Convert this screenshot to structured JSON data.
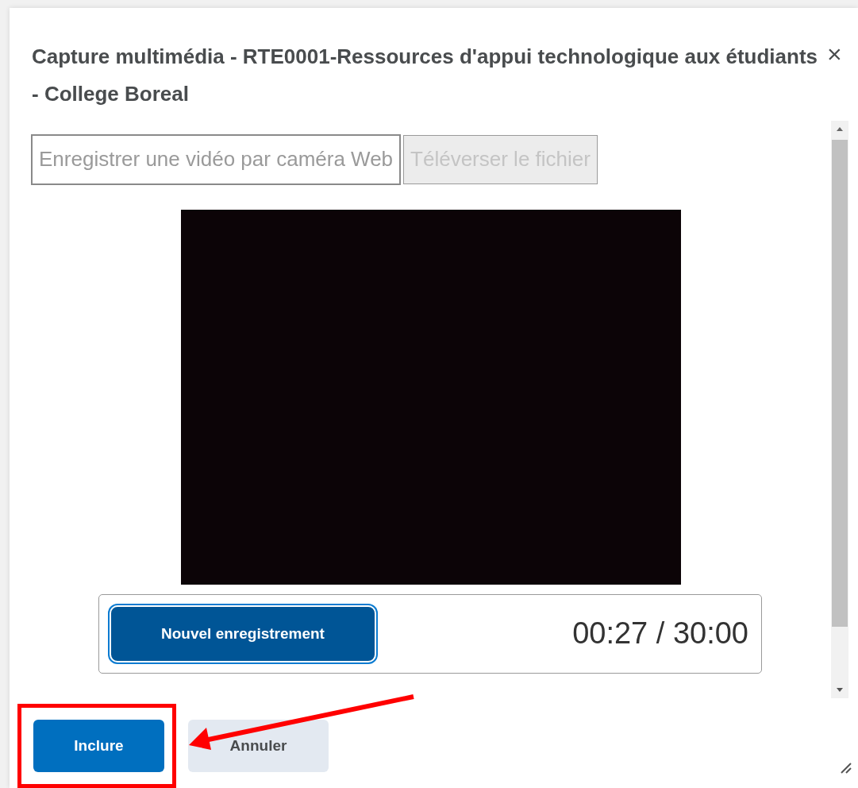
{
  "dialog": {
    "title": "Capture multimédia - RTE0001-Ressources d'appui technologique aux étudiants - College Boreal",
    "close": "×"
  },
  "tabs": [
    {
      "label": "Enregistrer une vidéo par caméra Web",
      "selected": true,
      "disabled": false
    },
    {
      "label": "Téléverser le fichier",
      "selected": false,
      "disabled": true
    }
  ],
  "recorder": {
    "button": "Nouvel enregistrement",
    "time": "00:27 / 30:00"
  },
  "footer": {
    "buttons": [
      {
        "label": "Inclure",
        "kind": "primary",
        "highlighted": true
      },
      {
        "label": "Annuler",
        "kind": "secondary",
        "highlighted": false
      }
    ]
  }
}
